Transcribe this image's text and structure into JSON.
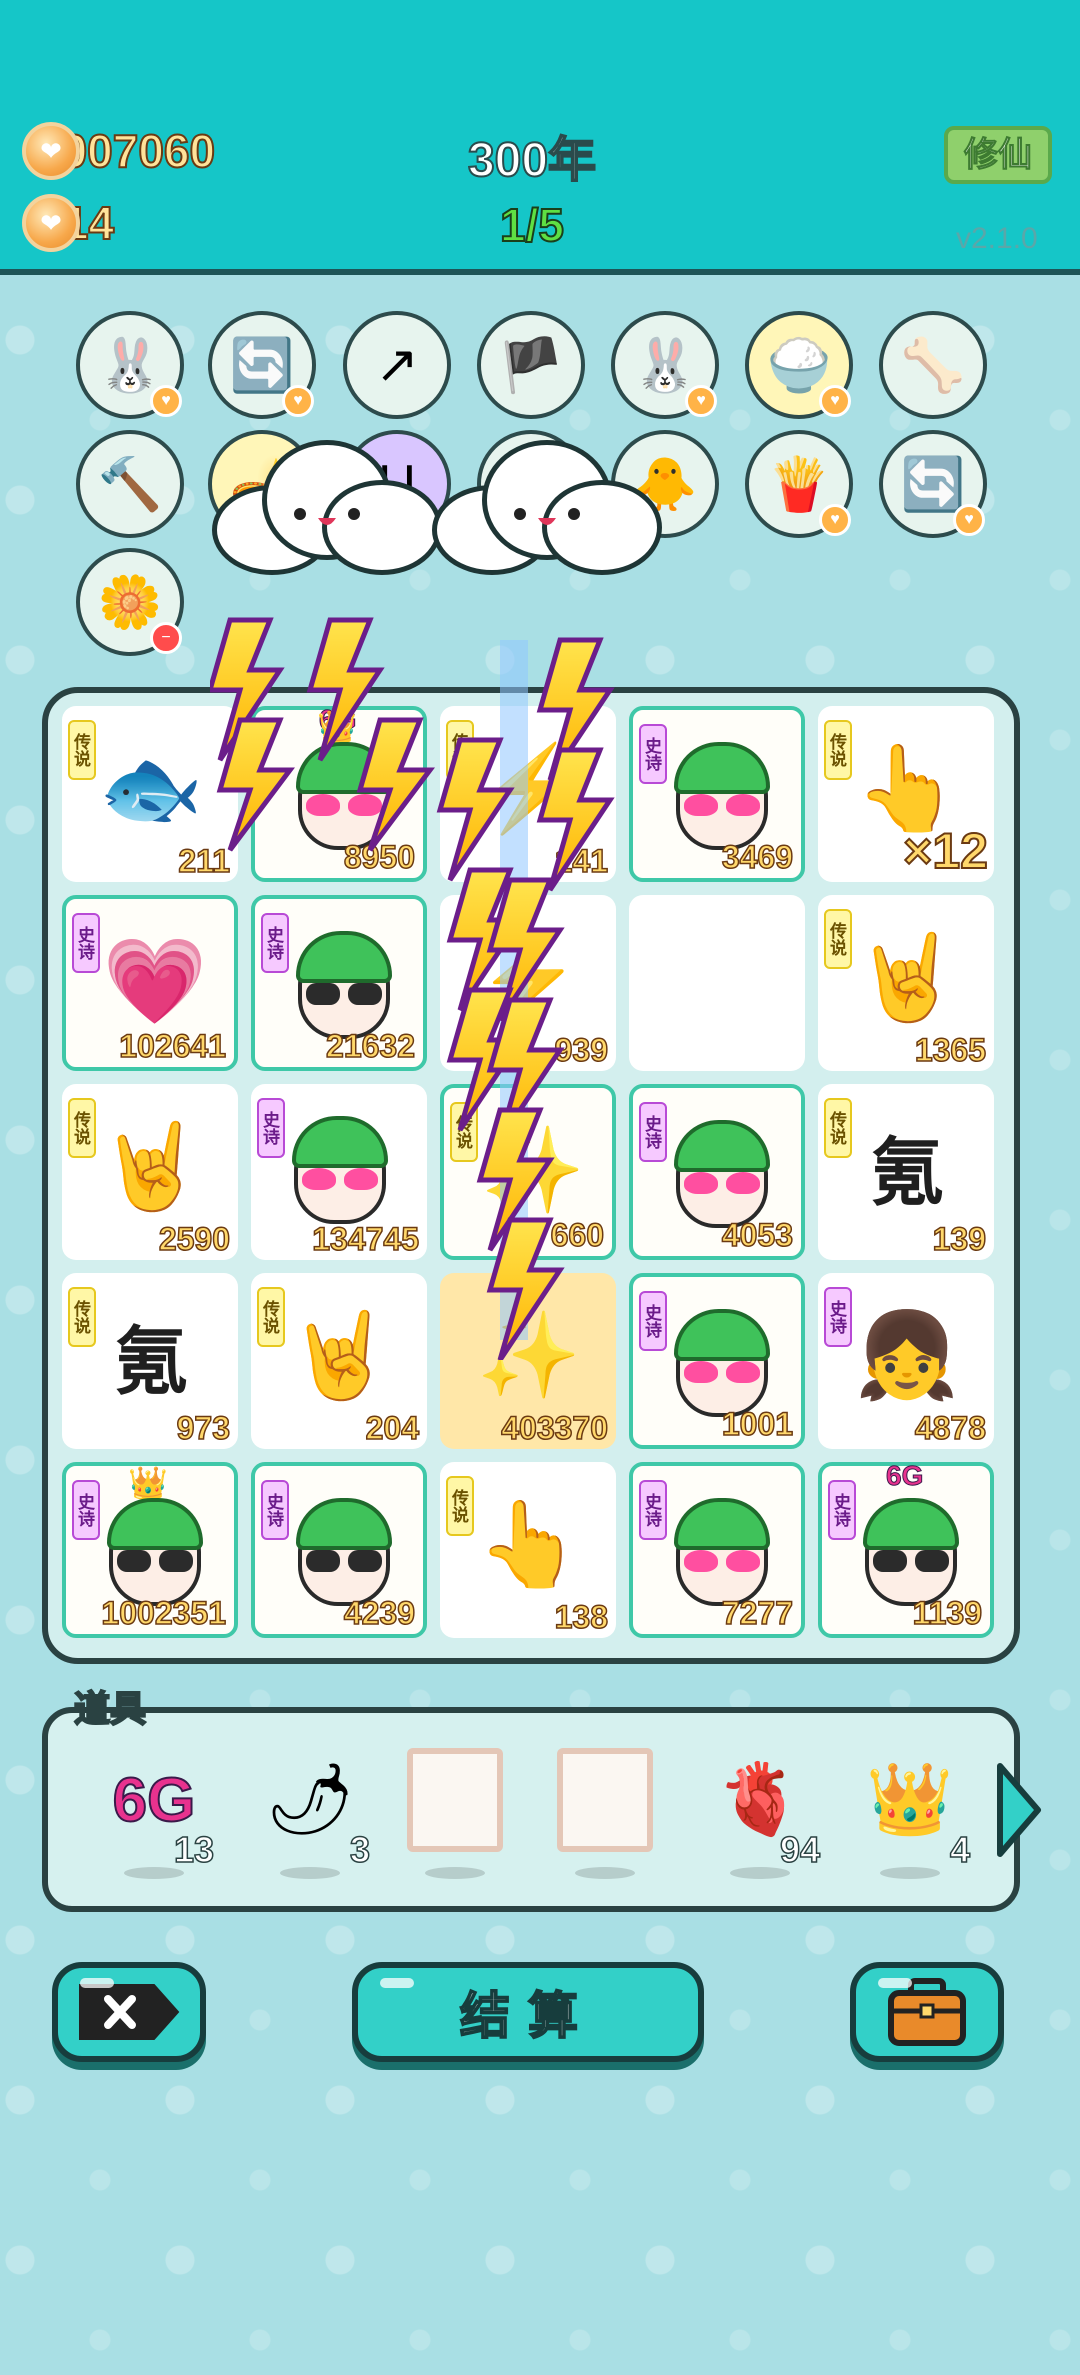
{
  "header": {
    "coins": "7007060",
    "coin_gain": "+14",
    "year": "300年",
    "stage": "1/5",
    "xiuxian_label": "修仙",
    "version": "v2.1.0"
  },
  "tags": {
    "legend": "传说",
    "epic": "史诗"
  },
  "item_circles_row1": [
    "rabbit-icon",
    "refresh-icon",
    "arrow-card-icon",
    "pirate-patch-icon",
    "rabbit-icon",
    "rice-bowl-icon",
    "dog-bowl-icon"
  ],
  "item_circles_row2": [
    "hammer-icon",
    "magic-lamp-icon",
    "card-u-icon",
    "bird-icon",
    "chick-icon",
    "fries-icon",
    "refresh-icon"
  ],
  "item_circles_row3": [
    "flower-pot-icon"
  ],
  "board": {
    "cells": [
      {
        "tag": "传说",
        "art": "koi-fish-icon",
        "value": "211"
      },
      {
        "tag": "",
        "art": "hearts-face-crown-icon",
        "value": "8950",
        "top": "6G"
      },
      {
        "tag": "传说",
        "art": "lightning-effect-icon",
        "value": "141"
      },
      {
        "tag": "史诗",
        "art": "hearts-face-icon",
        "value": "3469"
      },
      {
        "tag": "传说",
        "art": "pointing-hand-icon",
        "value": "×12"
      },
      {
        "tag": "史诗",
        "art": "glowing-heart-icon",
        "value": "102641"
      },
      {
        "tag": "史诗",
        "art": "sunglasses-face-icon",
        "value": "21632"
      },
      {
        "tag": "",
        "art": "lightning-effect-icon",
        "value": "939"
      },
      {
        "tag": "",
        "art": "",
        "value": ""
      },
      {
        "tag": "传说",
        "art": "rock-hand-icon",
        "value": "1365"
      },
      {
        "tag": "传说",
        "art": "rock-hand-icon",
        "value": "2590"
      },
      {
        "tag": "史诗",
        "art": "hearts-face-icon",
        "value": "134745"
      },
      {
        "tag": "传说",
        "art": "star-burst-icon",
        "value": "660"
      },
      {
        "tag": "史诗",
        "art": "hearts-face-icon",
        "value": "4053"
      },
      {
        "tag": "传说",
        "art": "krypton-glyph",
        "value": "139"
      },
      {
        "tag": "传说",
        "art": "krypton-glyph",
        "value": "973"
      },
      {
        "tag": "传说",
        "art": "rock-hand-icon",
        "value": "204"
      },
      {
        "tag": "",
        "art": "star-burst-icon",
        "value": "403370"
      },
      {
        "tag": "史诗",
        "art": "hearts-face-icon",
        "value": "1001"
      },
      {
        "tag": "史诗",
        "art": "girl-face-icon",
        "value": "4878"
      },
      {
        "tag": "史诗",
        "art": "crown-sunglasses-face-icon",
        "value": "1002351"
      },
      {
        "tag": "史诗",
        "art": "sunglasses-face-icon",
        "value": "4239"
      },
      {
        "tag": "传说",
        "art": "pointing-hand-icon",
        "value": "138"
      },
      {
        "tag": "史诗",
        "art": "hearts-face-icon",
        "value": "7277"
      },
      {
        "tag": "史诗",
        "art": "sunglasses-face-icon",
        "value": "1139",
        "top": "6G"
      }
    ],
    "krypton_glyph": "氪"
  },
  "tray": {
    "title": "道具",
    "items": [
      {
        "name": "6g-icon",
        "label": "6G",
        "count": "13"
      },
      {
        "name": "chili-icon",
        "count": "3"
      },
      {
        "name": "blank-frame-icon",
        "count": ""
      },
      {
        "name": "blank-frame-icon",
        "count": ""
      },
      {
        "name": "liver-icon",
        "count": "94"
      },
      {
        "name": "crown-icon",
        "count": "4"
      }
    ]
  },
  "buttons": {
    "settle": "结算"
  },
  "colors": {
    "header_bg": "#15c6c8",
    "page_bg": "#a9dfe4",
    "button_teal": "#33d0c8",
    "epic_tag": "#f6c9ff",
    "legend_tag": "#fff7a6"
  }
}
